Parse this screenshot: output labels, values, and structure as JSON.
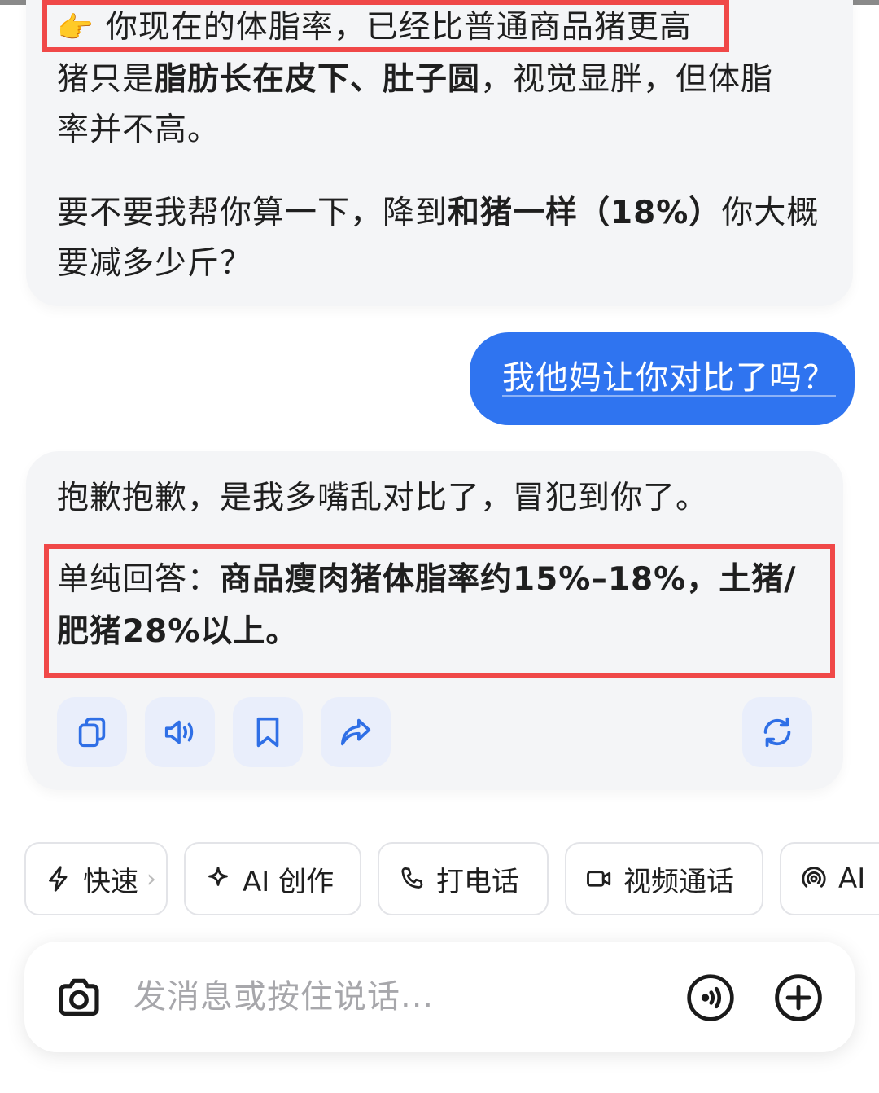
{
  "conversation": {
    "ai_message_1": {
      "line1_hand": "👉",
      "line1_text": "你现在的体脂率，已经比普通商品猪更高",
      "line2_a": "猪只是",
      "line2_b": "脂肪长在皮下、肚子圆",
      "line2_c": "，视觉显胖，但体脂",
      "line3": "率并不高。",
      "line4_a": "要不要我帮你算一下，降到",
      "line4_b": "和猪一样（18%）",
      "line4_c": "你大概",
      "line5": "要减多少斤？"
    },
    "user_message": "我他妈让你对比了吗？",
    "ai_message_2": {
      "line1": "抱歉抱歉，是我多嘴乱对比了，冒犯到你了。",
      "line2_a": "单纯回答：",
      "line2_b": "商品瘦肉猪体脂率约15%–18%，土猪/",
      "line3": "肥猪28%以上。"
    },
    "actions": {
      "copy_icon": "copy-icon",
      "speaker_icon": "speaker-icon",
      "bookmark_icon": "bookmark-icon",
      "share_icon": "share-icon",
      "regenerate_icon": "refresh-icon"
    }
  },
  "quick_actions": [
    {
      "label": "快速",
      "icon": "lightning-icon"
    },
    {
      "label": "AI 创作",
      "icon": "sparkle-icon"
    },
    {
      "label": "打电话",
      "icon": "phone-icon"
    },
    {
      "label": "视频通话",
      "icon": "video-icon"
    },
    {
      "label": "AI",
      "icon": "radio-icon"
    }
  ],
  "input": {
    "placeholder": "发消息或按住说话..."
  },
  "colors": {
    "accent": "#2f74f0",
    "highlight": "#f04848",
    "icon_blue": "#2f6fe6"
  }
}
